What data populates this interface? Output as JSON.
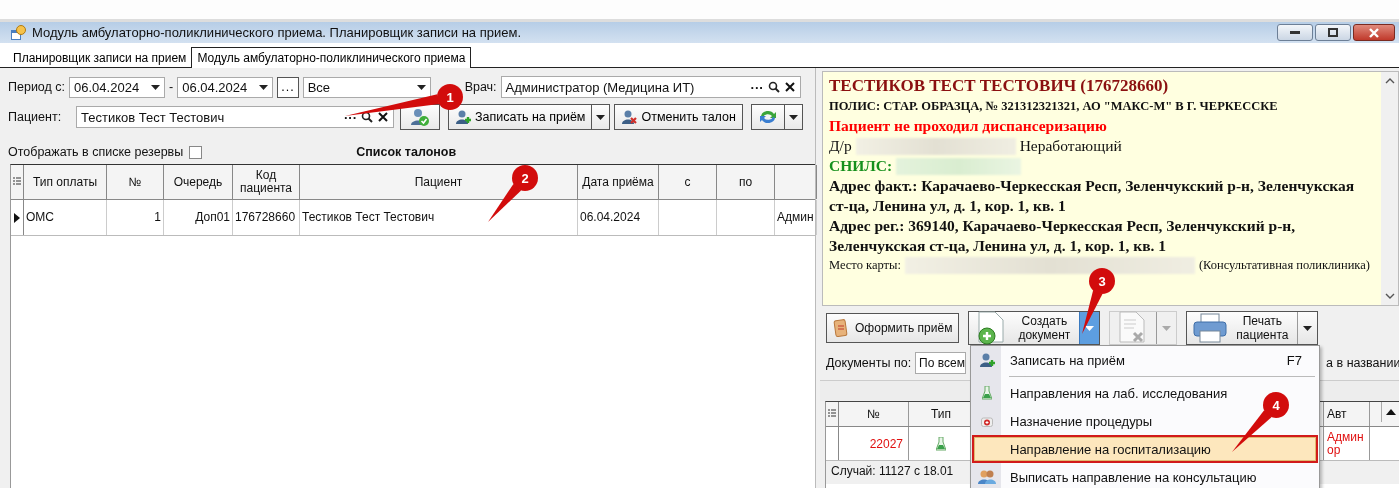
{
  "window": {
    "title": "Модуль амбулаторно-поликлинического приема. Планировщик записи на прием."
  },
  "tabs": [
    {
      "label": "Планировщик записи на прием",
      "selected": false
    },
    {
      "label": "Модуль амбулаторно-поликлинического приема",
      "selected": true
    }
  ],
  "filters": {
    "period_label": "Период с:",
    "date_from": "06.04.2024",
    "dash": "-",
    "date_to": "06.04.2024",
    "more_button": "...",
    "status_value": "Все",
    "doctor_label": "Врач:",
    "doctor_value": "Администратор (Медицина ИТ)",
    "patient_label": "Пациент:",
    "patient_value": "Тестиков Тест Тестович",
    "field_more": "···"
  },
  "toolbar": {
    "book_button": "Записать на приём",
    "cancel_button": "Отменить талон"
  },
  "reserve_checkbox": {
    "label": "Отображать в списке резервы",
    "checked": false
  },
  "list_title": "Список талонов",
  "table": {
    "columns": [
      "Тип оплаты",
      "№",
      "Очередь",
      "Код пациента",
      "Пациент",
      "Дата приёма",
      "с",
      "по",
      ""
    ],
    "rows": [
      {
        "cells": [
          "ОМС",
          "1",
          "Доп01",
          "176728660",
          "Тестиков Тест Тестович",
          "06.04.2024",
          "",
          "",
          "Админ"
        ],
        "selected": true
      }
    ]
  },
  "patient_info": {
    "name": "ТЕСТИКОВ ТЕСТ ТЕСТОВИЧ (176728660)",
    "policy": "ПОЛИС: СТАР. ОБРАЗЦА, № 321312321321, АО \"МАКС-М\" В Г. ЧЕРКЕССКЕ",
    "warning": "Пациент не проходил диспансеризацию",
    "dob_label": "Д/р",
    "employment": "Неработающий",
    "snils_label": "СНИЛС:",
    "address_fact": "Адрес факт.: Карачаево-Черкесская Респ, Зеленчукский р-н, Зеленчукская ст-ца, Ленина ул, д. 1, кор. 1, кв. 1",
    "address_reg": "Адрес рег.: 369140, Карачаево-Черкесская Респ, Зеленчукский р-н, Зеленчукская ст-ца, Ленина ул, д. 1, кор. 1, кв. 1",
    "place_label": "Место карты:",
    "place_value": "(Консультативная поликлиника)"
  },
  "actions": [
    {
      "kind": "visit",
      "label": "Оформить приём",
      "disabled": false,
      "split": false,
      "pressed": false
    },
    {
      "kind": "create",
      "label": "Создать документ",
      "disabled": false,
      "split": true,
      "pressed": true
    },
    {
      "kind": "delete",
      "disabled": true,
      "split": true,
      "pressed": false
    },
    {
      "kind": "print",
      "label": "Печать пациента",
      "disabled": false,
      "split": true,
      "pressed": false
    }
  ],
  "documents_filter": {
    "label": "Документы по:",
    "value": "По всем",
    "trailing": "а в названии"
  },
  "documents_table": {
    "columns": [
      "№",
      "Тип",
      "Авт"
    ],
    "row": {
      "number": "22027",
      "author_lines": [
        "Админ",
        "ор"
      ]
    },
    "case_line": "Случай: 11127 с 18.01"
  },
  "menu": [
    {
      "kind": "item",
      "label": "Записать на приём",
      "shortcut": "F7",
      "selected": false
    },
    {
      "kind": "separator"
    },
    {
      "kind": "item",
      "label": "Направления на лаб. исследования",
      "selected": false
    },
    {
      "kind": "item",
      "label": "Назначение процедуры",
      "selected": false
    },
    {
      "kind": "item",
      "label": "Направление на госпитализацию",
      "selected": true
    },
    {
      "kind": "item",
      "label": "Выписать направление на консультацию",
      "selected": false
    }
  ],
  "callouts": [
    {
      "number": "1"
    },
    {
      "number": "2"
    },
    {
      "number": "3"
    },
    {
      "number": "4"
    }
  ]
}
